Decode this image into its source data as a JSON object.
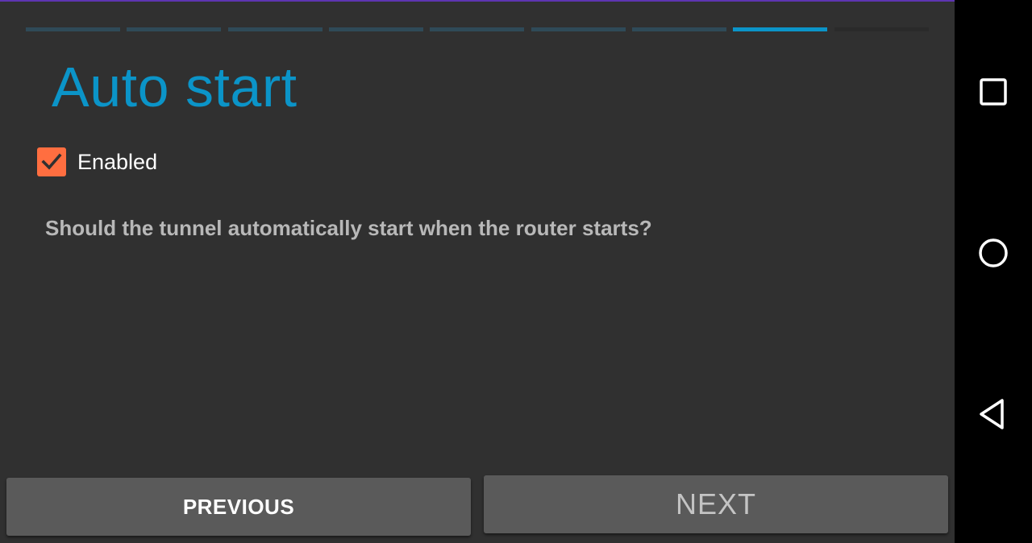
{
  "wizard": {
    "title": "Auto start",
    "progress": {
      "total_steps": 9,
      "current_step": 8
    },
    "checkbox": {
      "label": "Enabled",
      "checked": true
    },
    "description": "Should the tunnel automatically start when the router starts?",
    "buttons": {
      "previous": "PREVIOUS",
      "next": "NEXT"
    }
  },
  "navbar": {
    "icons": [
      "recents-icon",
      "home-icon",
      "back-icon"
    ]
  },
  "colors": {
    "accent": "#0b94c8",
    "checkbox": "#ff6e40",
    "background": "#303030",
    "button": "#5a5a5a",
    "top_line": "#5e35b1"
  }
}
